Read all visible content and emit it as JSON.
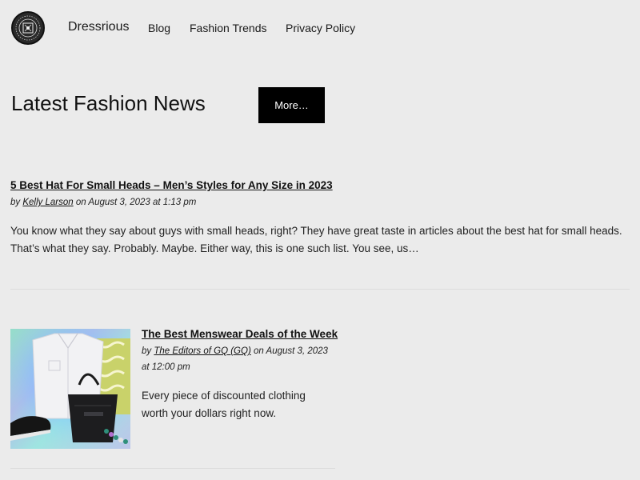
{
  "site": {
    "title": "Dressrious"
  },
  "nav": {
    "items": [
      {
        "label": "Blog"
      },
      {
        "label": "Fashion Trends"
      },
      {
        "label": "Privacy Policy"
      }
    ]
  },
  "section": {
    "title": "Latest Fashion News",
    "more_label": "More…"
  },
  "articles": [
    {
      "title": "5 Best Hat For Small Heads – Men’s Styles for Any Size in 2023",
      "by": "by",
      "author": "Kelly Larson",
      "date": "on August 3, 2023 at 1:13 pm",
      "excerpt": "You know what they say about guys with small heads, right? They have great taste in articles about the best hat for small heads. That’s what they say. Probably. Maybe. Either way, this is one such list. You see, us…"
    },
    {
      "title": "The Best Menswear Deals of the Week",
      "by": "by",
      "author": "The Editors of GQ (GQ)",
      "date": "on August 3, 2023 at 12:00 pm",
      "excerpt": "Every piece of discounted clothing worth your dollars right now."
    }
  ],
  "colors": {
    "background": "#ebebeb",
    "button_bg": "#000000",
    "button_text": "#ffffff",
    "text": "#1a1a1a"
  }
}
